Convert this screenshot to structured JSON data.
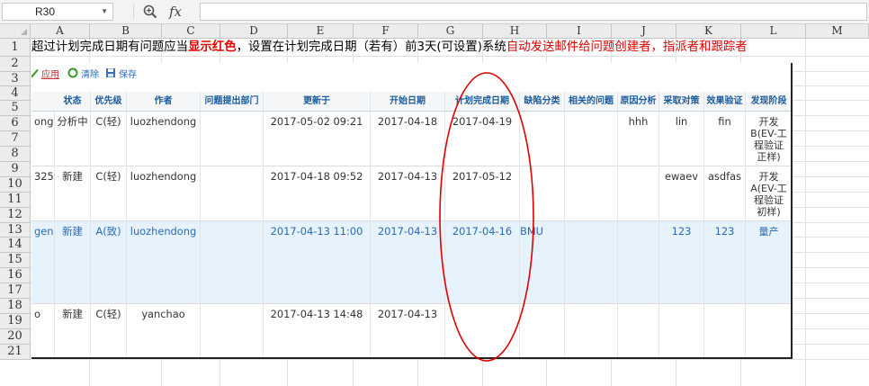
{
  "formula_bar": {
    "cell_ref": "R30",
    "zoom_icon": "magnifier-icon",
    "fx_label": "fx",
    "formula_value": ""
  },
  "columns": [
    "A",
    "B",
    "C",
    "D",
    "E",
    "F",
    "G",
    "H",
    "I",
    "J",
    "K",
    "L",
    "M"
  ],
  "rows": [
    "1",
    "2",
    "3",
    "4",
    "5",
    "6",
    "7",
    "8",
    "9",
    "10",
    "11",
    "12",
    "13",
    "14",
    "15",
    "16",
    "17",
    "18",
    "19",
    "20",
    "21"
  ],
  "banner": {
    "part1": "超过计划完成日期有问题应当",
    "part2": "显示红色",
    "part3": "，设置在计划完成日期（若有）前3天(可设置)系统",
    "part4": "自动发送邮件给问题创建者，指派者和跟踪者"
  },
  "toolbar": {
    "apply": "应用",
    "clear": "清除",
    "save": "保存"
  },
  "table": {
    "headers": [
      "状态",
      "优先级",
      "作者",
      "问题提出部门",
      "更新于",
      "开始日期",
      "计划完成日期",
      "缺陷分类",
      "相关的问题",
      "原因分析",
      "采取对策",
      "效果验证",
      "发现阶段"
    ],
    "rows": [
      {
        "id": "ong",
        "status": "分析中",
        "priority": "C(轻)",
        "author": "luozhendong",
        "dept": "",
        "updated": "2017-05-02 09:21",
        "start": "2017-04-18",
        "due": "2017-04-19",
        "defect": "",
        "related": "",
        "cause": "hhh",
        "measure": "lin",
        "verify": "fin",
        "phase": "开发B(EV-工程验证正样)"
      },
      {
        "id": "325",
        "status": "新建",
        "priority": "C(轻)",
        "author": "luozhendong",
        "dept": "",
        "updated": "2017-04-18 09:52",
        "start": "2017-04-13",
        "due": "2017-05-12",
        "defect": "",
        "related": "",
        "cause": "",
        "measure": "ewaev",
        "verify": "asdfas",
        "phase": "开发A(EV-工程验证初样)"
      },
      {
        "id": "gen",
        "status": "新建",
        "priority": "A(致)",
        "author": "luozhendong",
        "dept": "",
        "updated": "2017-04-13 11:00",
        "start": "2017-04-13",
        "due": "2017-04-16",
        "defect": "BMU",
        "related": "",
        "cause": "",
        "measure": "123",
        "verify": "123",
        "phase": "量产"
      },
      {
        "id": "o",
        "status": "新建",
        "priority": "C(轻)",
        "author": "yanchao",
        "dept": "",
        "updated": "2017-04-13 14:48",
        "start": "2017-04-13",
        "due": "",
        "defect": "",
        "related": "",
        "cause": "",
        "measure": "",
        "verify": "",
        "phase": ""
      }
    ]
  },
  "colors": {
    "banner_red": "#e00000",
    "header_blue": "#1a5a9a",
    "highlight_row": "#e6f3fc",
    "annotation_ellipse": "#e00000"
  }
}
